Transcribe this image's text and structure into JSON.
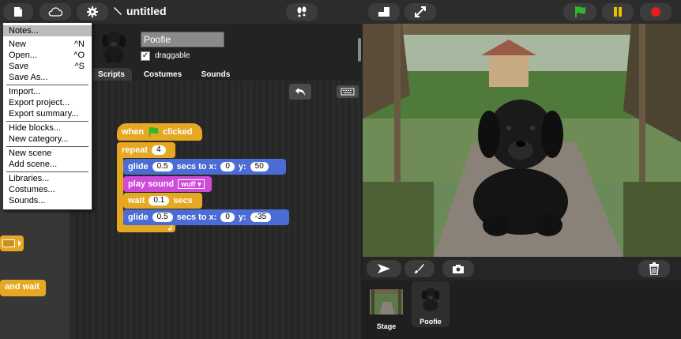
{
  "app": {
    "project_title": "untitled"
  },
  "sprite": {
    "name": "Poofie",
    "draggable_label": "draggable",
    "draggable_checked": true
  },
  "tabs": [
    {
      "label": "Scripts",
      "active": true
    },
    {
      "label": "Costumes",
      "active": false
    },
    {
      "label": "Sounds",
      "active": false
    }
  ],
  "palette": {
    "partial_block_1": "",
    "partial_block_2": "and wait"
  },
  "script": {
    "hat": {
      "prefix": "when",
      "suffix": "clicked"
    },
    "repeat": {
      "label": "repeat",
      "count": "4"
    },
    "glide1": {
      "label": "glide",
      "secs": "0.5",
      "mid": "secs to x:",
      "x": "0",
      "ylabel": "y:",
      "y": "50"
    },
    "play": {
      "label": "play sound",
      "sound": "wuff"
    },
    "wait": {
      "label": "wait",
      "secs": "0.1",
      "suffix": "secs"
    },
    "glide2": {
      "label": "glide",
      "secs": "0.5",
      "mid": "secs to x:",
      "x": "0",
      "ylabel": "y:",
      "y": "-35"
    }
  },
  "menu": {
    "items": [
      {
        "label": "Notes...",
        "shortcut": "",
        "highlighted": true
      },
      {
        "label": "New",
        "shortcut": "^N"
      },
      {
        "label": "Open...",
        "shortcut": "^O"
      },
      {
        "label": "Save",
        "shortcut": "^S"
      },
      {
        "label": "Save As...",
        "shortcut": ""
      },
      {
        "label": "Import...",
        "shortcut": ""
      },
      {
        "label": "Export project...",
        "shortcut": ""
      },
      {
        "label": "Export summary...",
        "shortcut": ""
      },
      {
        "label": "Hide blocks...",
        "shortcut": ""
      },
      {
        "label": "New category...",
        "shortcut": ""
      },
      {
        "label": "New scene",
        "shortcut": ""
      },
      {
        "label": "Add scene...",
        "shortcut": ""
      },
      {
        "label": "Libraries...",
        "shortcut": ""
      },
      {
        "label": "Costumes...",
        "shortcut": ""
      },
      {
        "label": "Sounds...",
        "shortcut": ""
      }
    ]
  },
  "corral": {
    "stage_label": "Stage",
    "sprite_label": "Poofie"
  },
  "colors": {
    "control": "#e6a822",
    "motion": "#4a6cd4",
    "sound": "#cf4ad9",
    "green_flag": "#2fb52f",
    "pause": "#e6c200",
    "stop": "#e02020"
  }
}
